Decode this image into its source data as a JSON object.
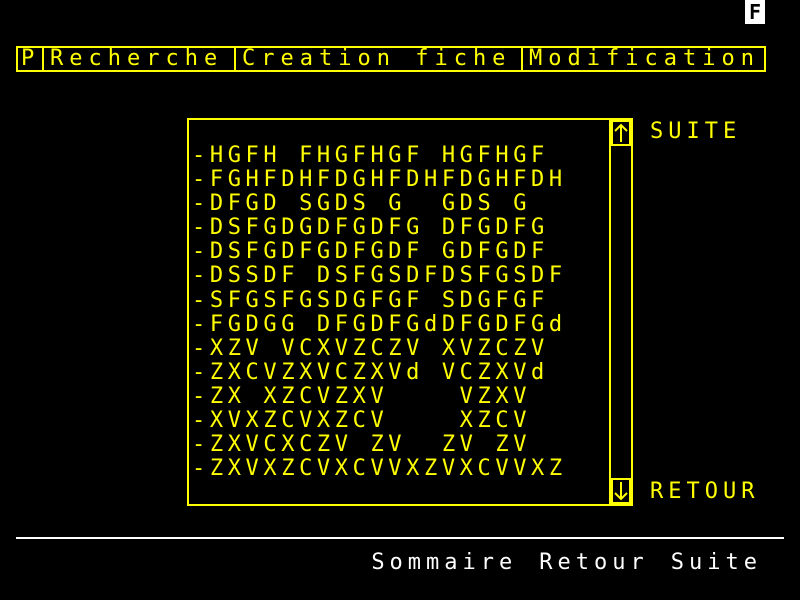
{
  "mode_indicator": "F",
  "menu": {
    "items": [
      {
        "label": "P"
      },
      {
        "label": "Recherche"
      },
      {
        "label": "Creation fiche"
      },
      {
        "label": "Modification"
      }
    ]
  },
  "list": {
    "items": [
      "-HGFH FHGFHGF HGFHGF",
      "-FGHFDHFDGHFDHFDGHFDH",
      "-DFGD SGDS G  GDS G",
      "-DSFGDGDFGDFG DFGDFG",
      "-DSFGDFGDFGDF GDFGDF",
      "-DSSDF DSFGSDFDSFGSDF",
      "-SFGSFGSDGFGF SDGFGF",
      "-FGDGG DFGDFGdDFGDFGd",
      "-XZV VCXVZCZV XVZCZV",
      "-ZXCVZXVCZXVd VCZXVd",
      "-ZX XZCVZXV    VZXV",
      "-XVXZCVXZCV    XZCV",
      "-ZXVCXCZV ZV  ZV ZV",
      "-ZXVXZCVXCVVXZVXCVVXZ"
    ]
  },
  "scrollbar": {
    "up_icon": "arrow-up-icon",
    "down_icon": "arrow-down-icon"
  },
  "side": {
    "suite_label": "SUITE",
    "retour_label": "RETOUR"
  },
  "bottom": {
    "sommaire_label": "Sommaire",
    "retour_label": "Retour",
    "suite_label": "Suite"
  },
  "colors": {
    "background": "#000000",
    "foreground": "#ffff00",
    "footer": "#ffffff"
  }
}
